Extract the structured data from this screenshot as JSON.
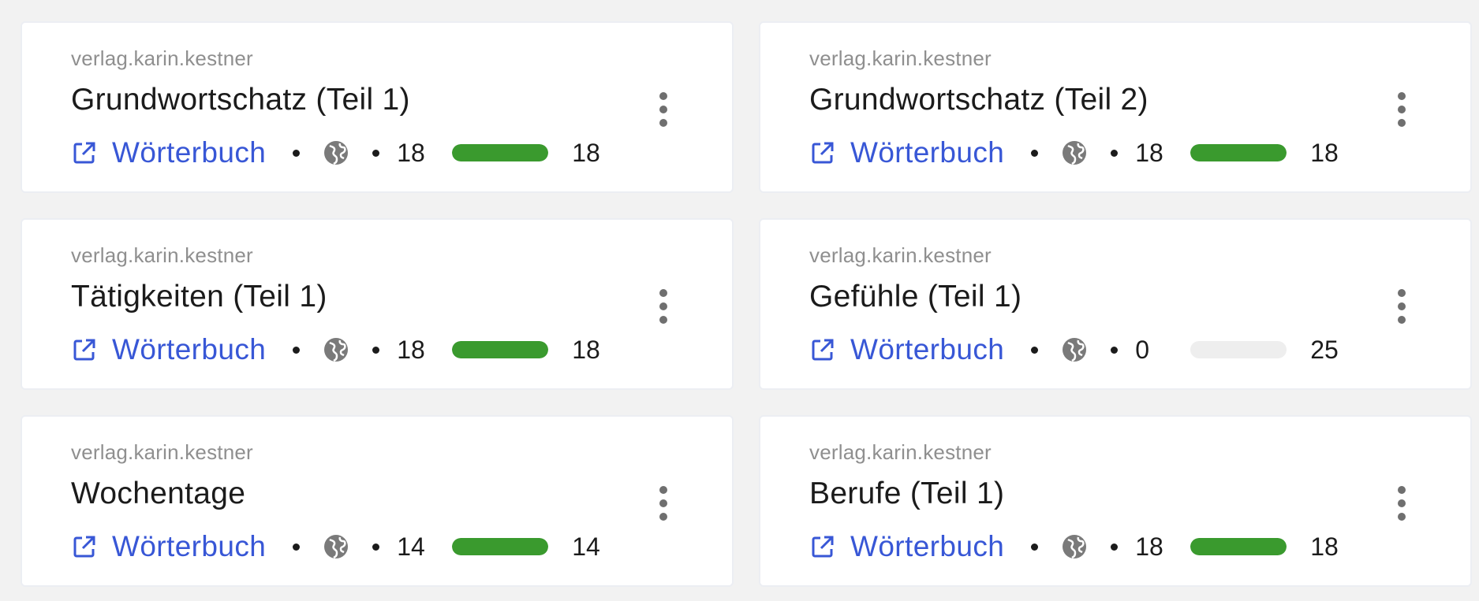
{
  "colors": {
    "link": "#3857d6",
    "progress": "#3a9a2e",
    "progress_track": "#eeeeee"
  },
  "cards": [
    {
      "owner": "verlag.karin.kestner",
      "title": "Grundwortschatz (Teil 1)",
      "link_label": "Wörterbuch",
      "visibility_icon": "globe-icon",
      "learned": "18",
      "total": "18",
      "progress": 1.0
    },
    {
      "owner": "verlag.karin.kestner",
      "title": "Grundwortschatz (Teil 2)",
      "link_label": "Wörterbuch",
      "visibility_icon": "globe-icon",
      "learned": "18",
      "total": "18",
      "progress": 1.0
    },
    {
      "owner": "verlag.karin.kestner",
      "title": "Tätigkeiten (Teil 1)",
      "link_label": "Wörterbuch",
      "visibility_icon": "globe-icon",
      "learned": "18",
      "total": "18",
      "progress": 1.0
    },
    {
      "owner": "verlag.karin.kestner",
      "title": "Gefühle (Teil 1)",
      "link_label": "Wörterbuch",
      "visibility_icon": "globe-icon",
      "learned": "0",
      "total": "25",
      "progress": 0.0
    },
    {
      "owner": "verlag.karin.kestner",
      "title": "Wochentage",
      "link_label": "Wörterbuch",
      "visibility_icon": "globe-icon",
      "learned": "14",
      "total": "14",
      "progress": 1.0
    },
    {
      "owner": "verlag.karin.kestner",
      "title": "Berufe (Teil 1)",
      "link_label": "Wörterbuch",
      "visibility_icon": "globe-icon",
      "learned": "18",
      "total": "18",
      "progress": 1.0
    }
  ]
}
